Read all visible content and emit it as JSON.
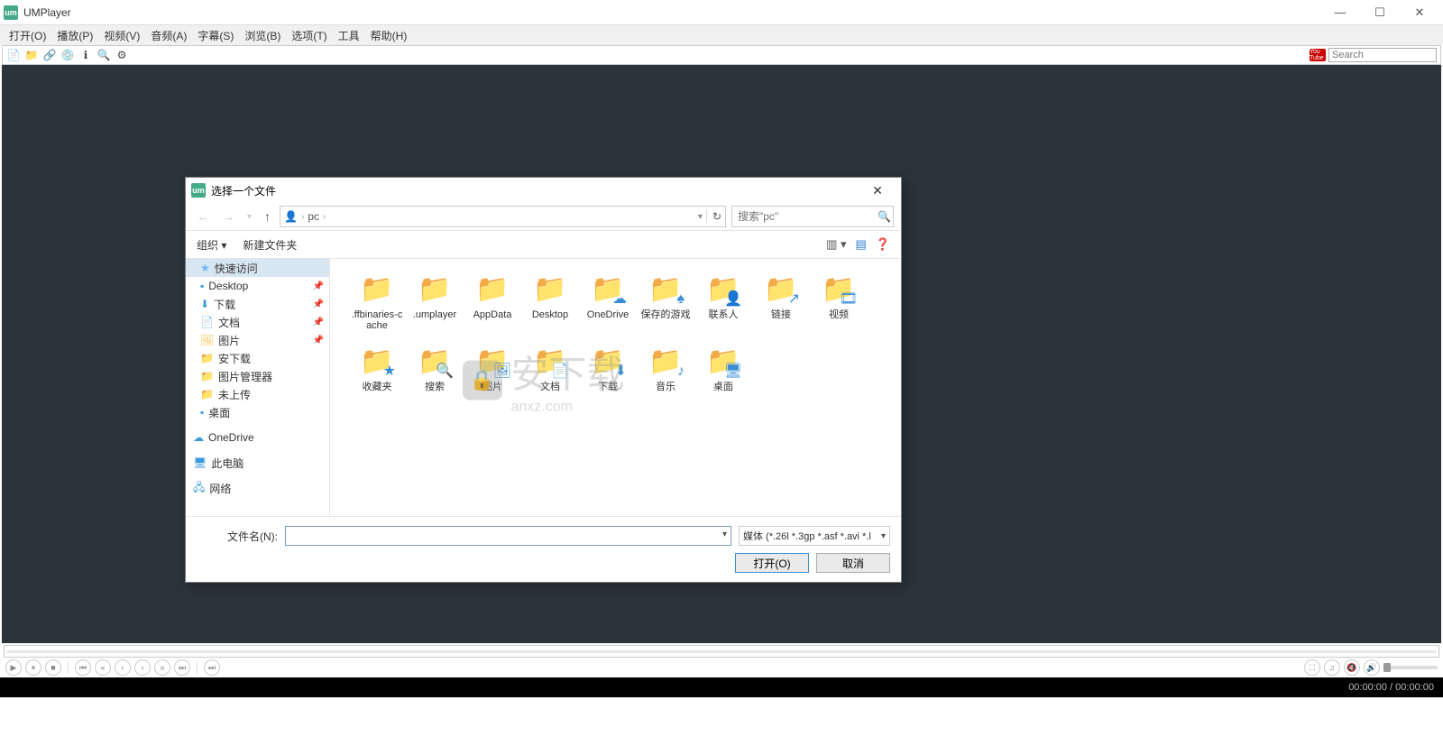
{
  "app": {
    "title": "UMPlayer"
  },
  "menu": [
    "打开(O)",
    "播放(P)",
    "视频(V)",
    "音频(A)",
    "字幕(S)",
    "浏览(B)",
    "选项(T)",
    "工具",
    "帮助(H)"
  ],
  "toolbar": {
    "search_placeholder": "Search",
    "yt_label": "You Tube"
  },
  "status": {
    "time": "00:00:00 / 00:00:00"
  },
  "dialog": {
    "title": "选择一个文件",
    "crumb_user": "pc",
    "search_placeholder": "搜索\"pc\"",
    "organize": "组织",
    "new_folder": "新建文件夹",
    "sidebar": {
      "quick": "快速访问",
      "desktop": "Desktop",
      "downloads": "下载",
      "documents": "文档",
      "pictures": "图片",
      "anxiazai": "安下载",
      "picmgr": "图片管理器",
      "weishangchuan": "未上传",
      "desktop2": "桌面",
      "onedrive": "OneDrive",
      "thispc": "此电脑",
      "network": "网络"
    },
    "files": [
      {
        "name": ".ffbinaries-cache",
        "icon": "folder"
      },
      {
        "name": ".umplayer",
        "icon": "folder"
      },
      {
        "name": "AppData",
        "icon": "folder"
      },
      {
        "name": "Desktop",
        "icon": "folder"
      },
      {
        "name": "OneDrive",
        "icon": "folder-cloud"
      },
      {
        "name": "保存的游戏",
        "icon": "folder-game"
      },
      {
        "name": "联系人",
        "icon": "folder-contact"
      },
      {
        "name": "链接",
        "icon": "folder-link"
      },
      {
        "name": "视频",
        "icon": "folder-video"
      },
      {
        "name": "收藏夹",
        "icon": "folder-star"
      },
      {
        "name": "搜索",
        "icon": "folder-search"
      },
      {
        "name": "图片",
        "icon": "folder-image"
      },
      {
        "name": "文档",
        "icon": "folder-doc"
      },
      {
        "name": "下载",
        "icon": "folder-down"
      },
      {
        "name": "音乐",
        "icon": "folder-music"
      },
      {
        "name": "桌面",
        "icon": "folder-desktop"
      }
    ],
    "filename_label": "文件名(N):",
    "type_filter": "媒体 (*.26l *.3gp *.asf *.avi *.l",
    "open_btn": "打开(O)",
    "cancel_btn": "取消"
  },
  "watermark": {
    "main": "安下载",
    "sub": "anxz.com"
  }
}
